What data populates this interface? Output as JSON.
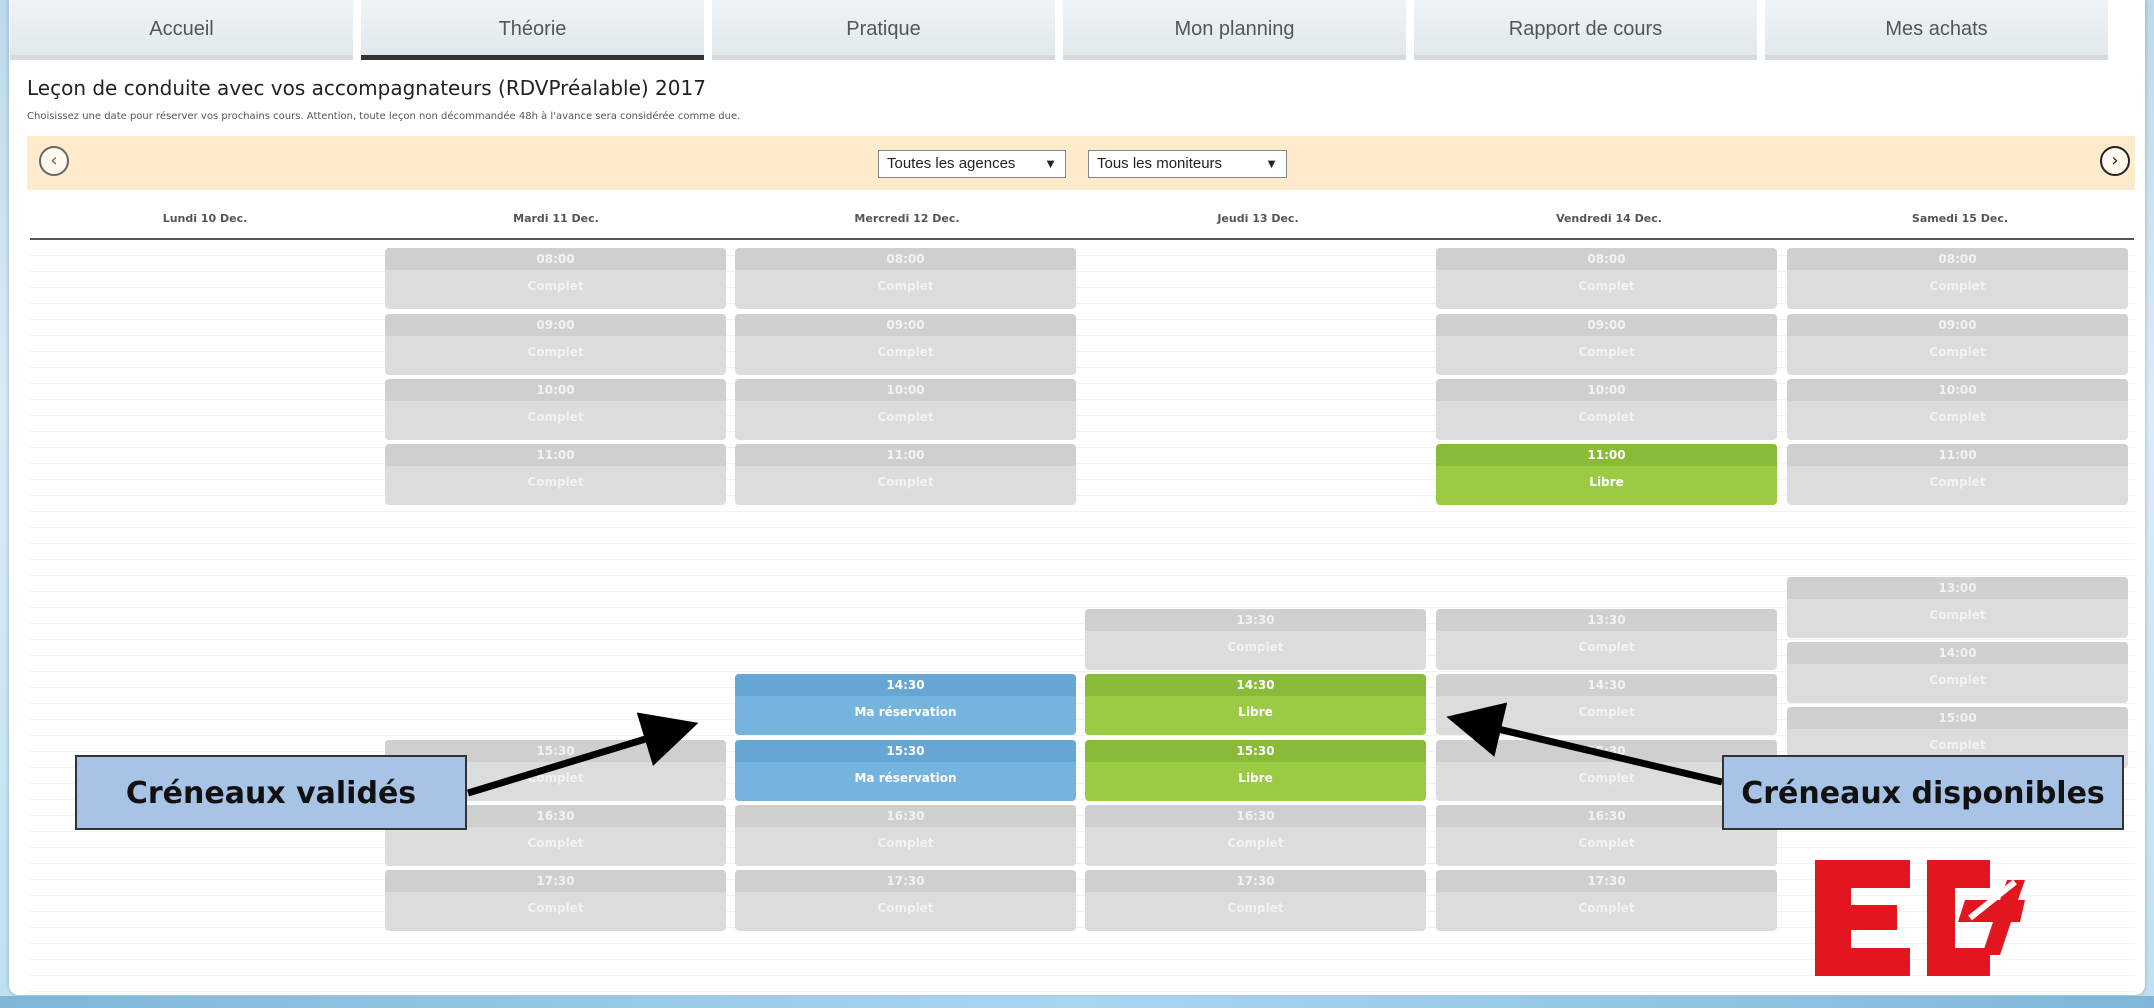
{
  "nav": {
    "tabs": [
      {
        "label": "Accueil",
        "active": false
      },
      {
        "label": "Théorie",
        "active": true
      },
      {
        "label": "Pratique",
        "active": false
      },
      {
        "label": "Mon planning",
        "active": false
      },
      {
        "label": "Rapport de cours",
        "active": false
      },
      {
        "label": "Mes achats",
        "active": false
      }
    ]
  },
  "page": {
    "title": "Leçon de conduite avec vos accompagnateurs (RDVPréalable) 2017",
    "subtitle": "Choisissez une date pour réserver vos prochains cours. Attention, toute leçon non décommandée 48h à l'avance sera considérée comme due."
  },
  "filters": {
    "prev_icon": "‹",
    "next_icon": "›",
    "agency_select": "Toutes les agences",
    "instructor_select": "Tous les moniteurs",
    "select_arrow": "▼"
  },
  "days": [
    {
      "label": "Lundi 10 Dec.",
      "slots": []
    },
    {
      "label": "Mardi 11 Dec.",
      "slots": [
        {
          "time": "08:00",
          "status": "Complet",
          "kind": "full"
        },
        {
          "time": "09:00",
          "status": "Complet",
          "kind": "full"
        },
        {
          "time": "10:00",
          "status": "Complet",
          "kind": "full"
        },
        {
          "time": "11:00",
          "status": "Complet",
          "kind": "full"
        },
        {
          "time": "15:30",
          "status": "Complet",
          "kind": "full"
        },
        {
          "time": "16:30",
          "status": "Complet",
          "kind": "full"
        },
        {
          "time": "17:30",
          "status": "Complet",
          "kind": "full"
        }
      ]
    },
    {
      "label": "Mercredi 12 Dec.",
      "slots": [
        {
          "time": "08:00",
          "status": "Complet",
          "kind": "full"
        },
        {
          "time": "09:00",
          "status": "Complet",
          "kind": "full"
        },
        {
          "time": "10:00",
          "status": "Complet",
          "kind": "full"
        },
        {
          "time": "11:00",
          "status": "Complet",
          "kind": "full"
        },
        {
          "time": "14:30",
          "status": "Ma réservation",
          "kind": "resa"
        },
        {
          "time": "15:30",
          "status": "Ma réservation",
          "kind": "resa"
        },
        {
          "time": "16:30",
          "status": "Complet",
          "kind": "full"
        },
        {
          "time": "17:30",
          "status": "Complet",
          "kind": "full"
        }
      ]
    },
    {
      "label": "Jeudi 13 Dec.",
      "slots": [
        {
          "time": "13:30",
          "status": "Complet",
          "kind": "full"
        },
        {
          "time": "14:30",
          "status": "Libre",
          "kind": "libre"
        },
        {
          "time": "15:30",
          "status": "Libre",
          "kind": "libre"
        },
        {
          "time": "16:30",
          "status": "Complet",
          "kind": "full"
        },
        {
          "time": "17:30",
          "status": "Complet",
          "kind": "full"
        }
      ]
    },
    {
      "label": "Vendredi 14 Dec.",
      "slots": [
        {
          "time": "08:00",
          "status": "Complet",
          "kind": "full"
        },
        {
          "time": "09:00",
          "status": "Complet",
          "kind": "full"
        },
        {
          "time": "10:00",
          "status": "Complet",
          "kind": "full"
        },
        {
          "time": "11:00",
          "status": "Libre",
          "kind": "libre"
        },
        {
          "time": "13:30",
          "status": "Complet",
          "kind": "full"
        },
        {
          "time": "14:30",
          "status": "Complet",
          "kind": "full"
        },
        {
          "time": "15:30",
          "status": "Complet",
          "kind": "full"
        },
        {
          "time": "16:30",
          "status": "Complet",
          "kind": "full"
        },
        {
          "time": "17:30",
          "status": "Complet",
          "kind": "full"
        }
      ]
    },
    {
      "label": "Samedi 15 Dec.",
      "slots": [
        {
          "time": "08:00",
          "status": "Complet",
          "kind": "full"
        },
        {
          "time": "09:00",
          "status": "Complet",
          "kind": "full"
        },
        {
          "time": "10:00",
          "status": "Complet",
          "kind": "full"
        },
        {
          "time": "11:00",
          "status": "Complet",
          "kind": "full"
        },
        {
          "time": "13:00",
          "status": "Complet",
          "kind": "full"
        },
        {
          "time": "14:00",
          "status": "Complet",
          "kind": "full"
        },
        {
          "time": "15:00",
          "status": "Complet",
          "kind": "full"
        }
      ]
    }
  ],
  "annotations": {
    "left": "Créneaux validés",
    "right": "Créneaux disponibles"
  },
  "colors": {
    "libre": "#9bcb45",
    "reservation": "#76b4e0",
    "complet": "#dcdcdc",
    "logo_red": "#e3161f"
  }
}
